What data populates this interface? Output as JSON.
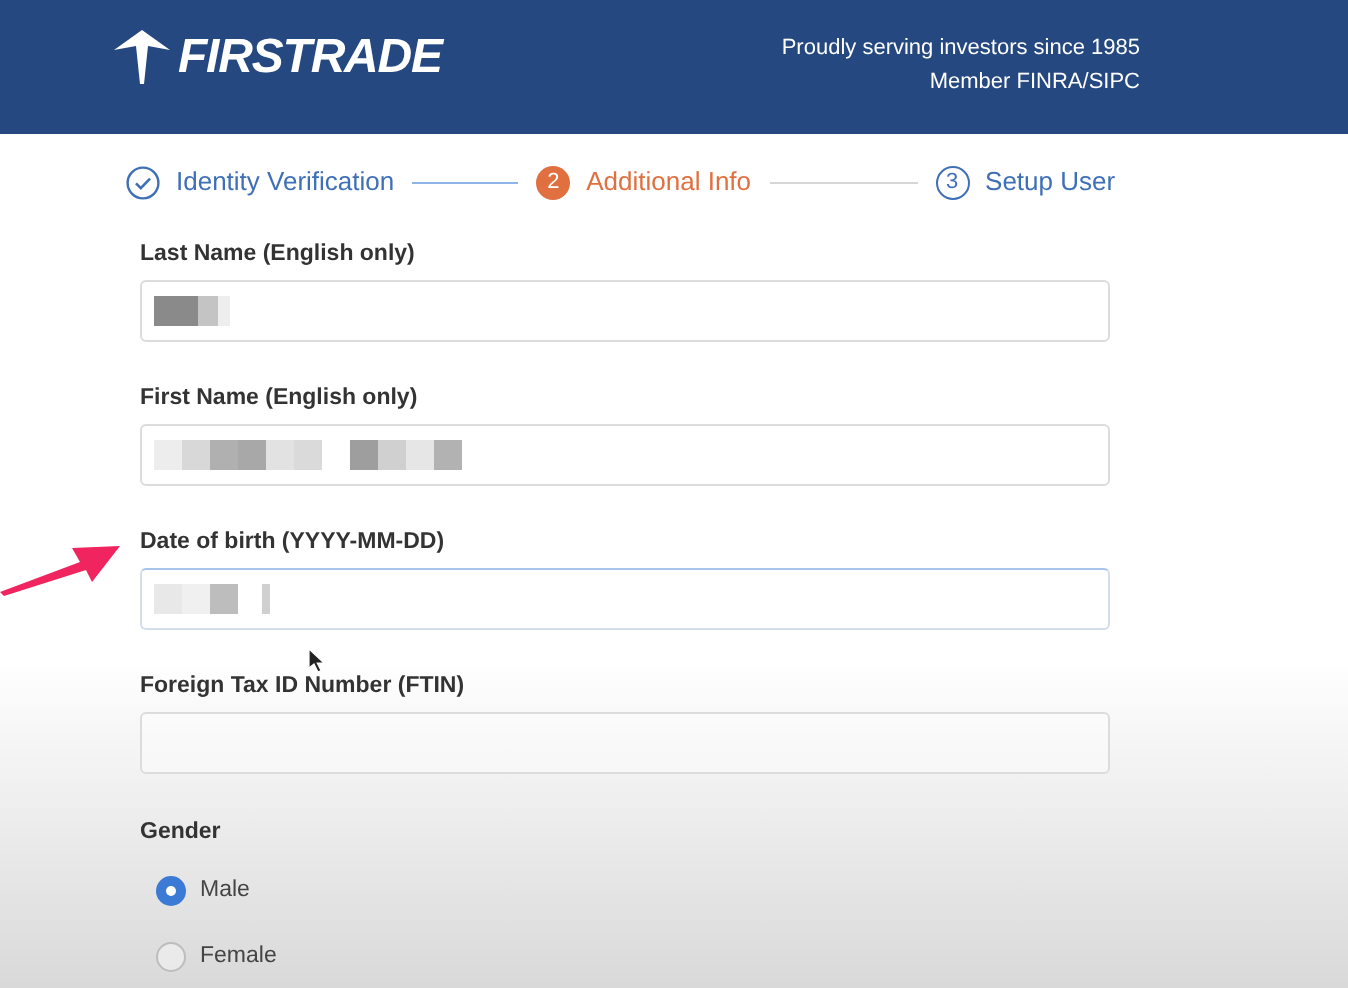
{
  "header": {
    "logo": "FIRSTRADE",
    "tagline": "Proudly serving investors since 1985",
    "membership": "Member FINRA/SIPC"
  },
  "steps": [
    {
      "label": "Identity Verification",
      "completed": true,
      "selected": false
    },
    {
      "number": "2",
      "label": "Additional Info",
      "completed": false,
      "selected": true
    },
    {
      "number": "3",
      "label": "Setup User",
      "completed": false,
      "selected": false
    }
  ],
  "fields": [
    {
      "label": "Last Name (English only)",
      "redacted": true,
      "focused": false
    },
    {
      "label": "First Name (English only)",
      "redacted": true,
      "focused": false
    },
    {
      "label": "Date of birth (YYYY-MM-DD)",
      "redacted": true,
      "focused": true
    },
    {
      "label": "Foreign Tax ID Number (FTIN)",
      "redacted": false,
      "focused": false
    }
  ],
  "gender": {
    "label": "Gender",
    "options": [
      {
        "label": "Male",
        "selected": true
      },
      {
        "label": "Female",
        "selected": false
      }
    ]
  }
}
